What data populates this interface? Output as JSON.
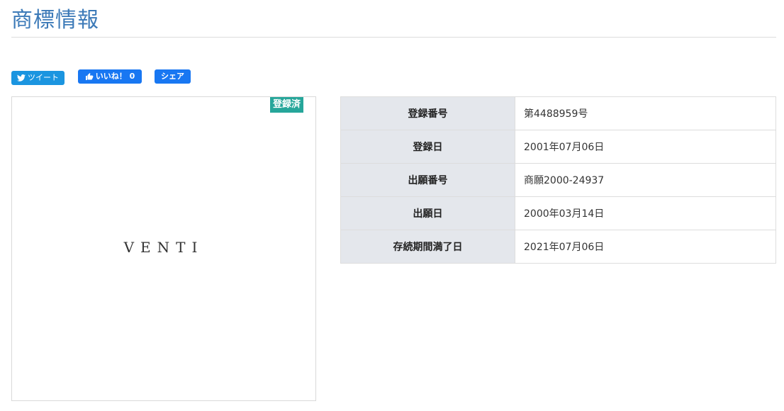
{
  "page": {
    "title": "商標情報"
  },
  "social": {
    "tweet_label": "ツイート",
    "like_label": "いいね！ 0",
    "share_label": "シェア"
  },
  "trademark": {
    "mark_text": "VENTI",
    "status_badge": "登録済"
  },
  "info": {
    "rows": [
      {
        "label": "登録番号",
        "value": "第4488959号"
      },
      {
        "label": "登録日",
        "value": "2001年07月06日"
      },
      {
        "label": "出願番号",
        "value": "商願2000-24937"
      },
      {
        "label": "出願日",
        "value": "2000年03月14日"
      },
      {
        "label": "存続期間満了日",
        "value": "2021年07月06日"
      }
    ]
  },
  "colors": {
    "title": "#3c7ab8",
    "twitter": "#1b95e0",
    "facebook": "#1877f2",
    "badge": "#26a69a",
    "label_bg": "#e4e7ec"
  },
  "icons": {
    "tweet": "twitter-bird-icon",
    "like": "thumbs-up-icon"
  }
}
